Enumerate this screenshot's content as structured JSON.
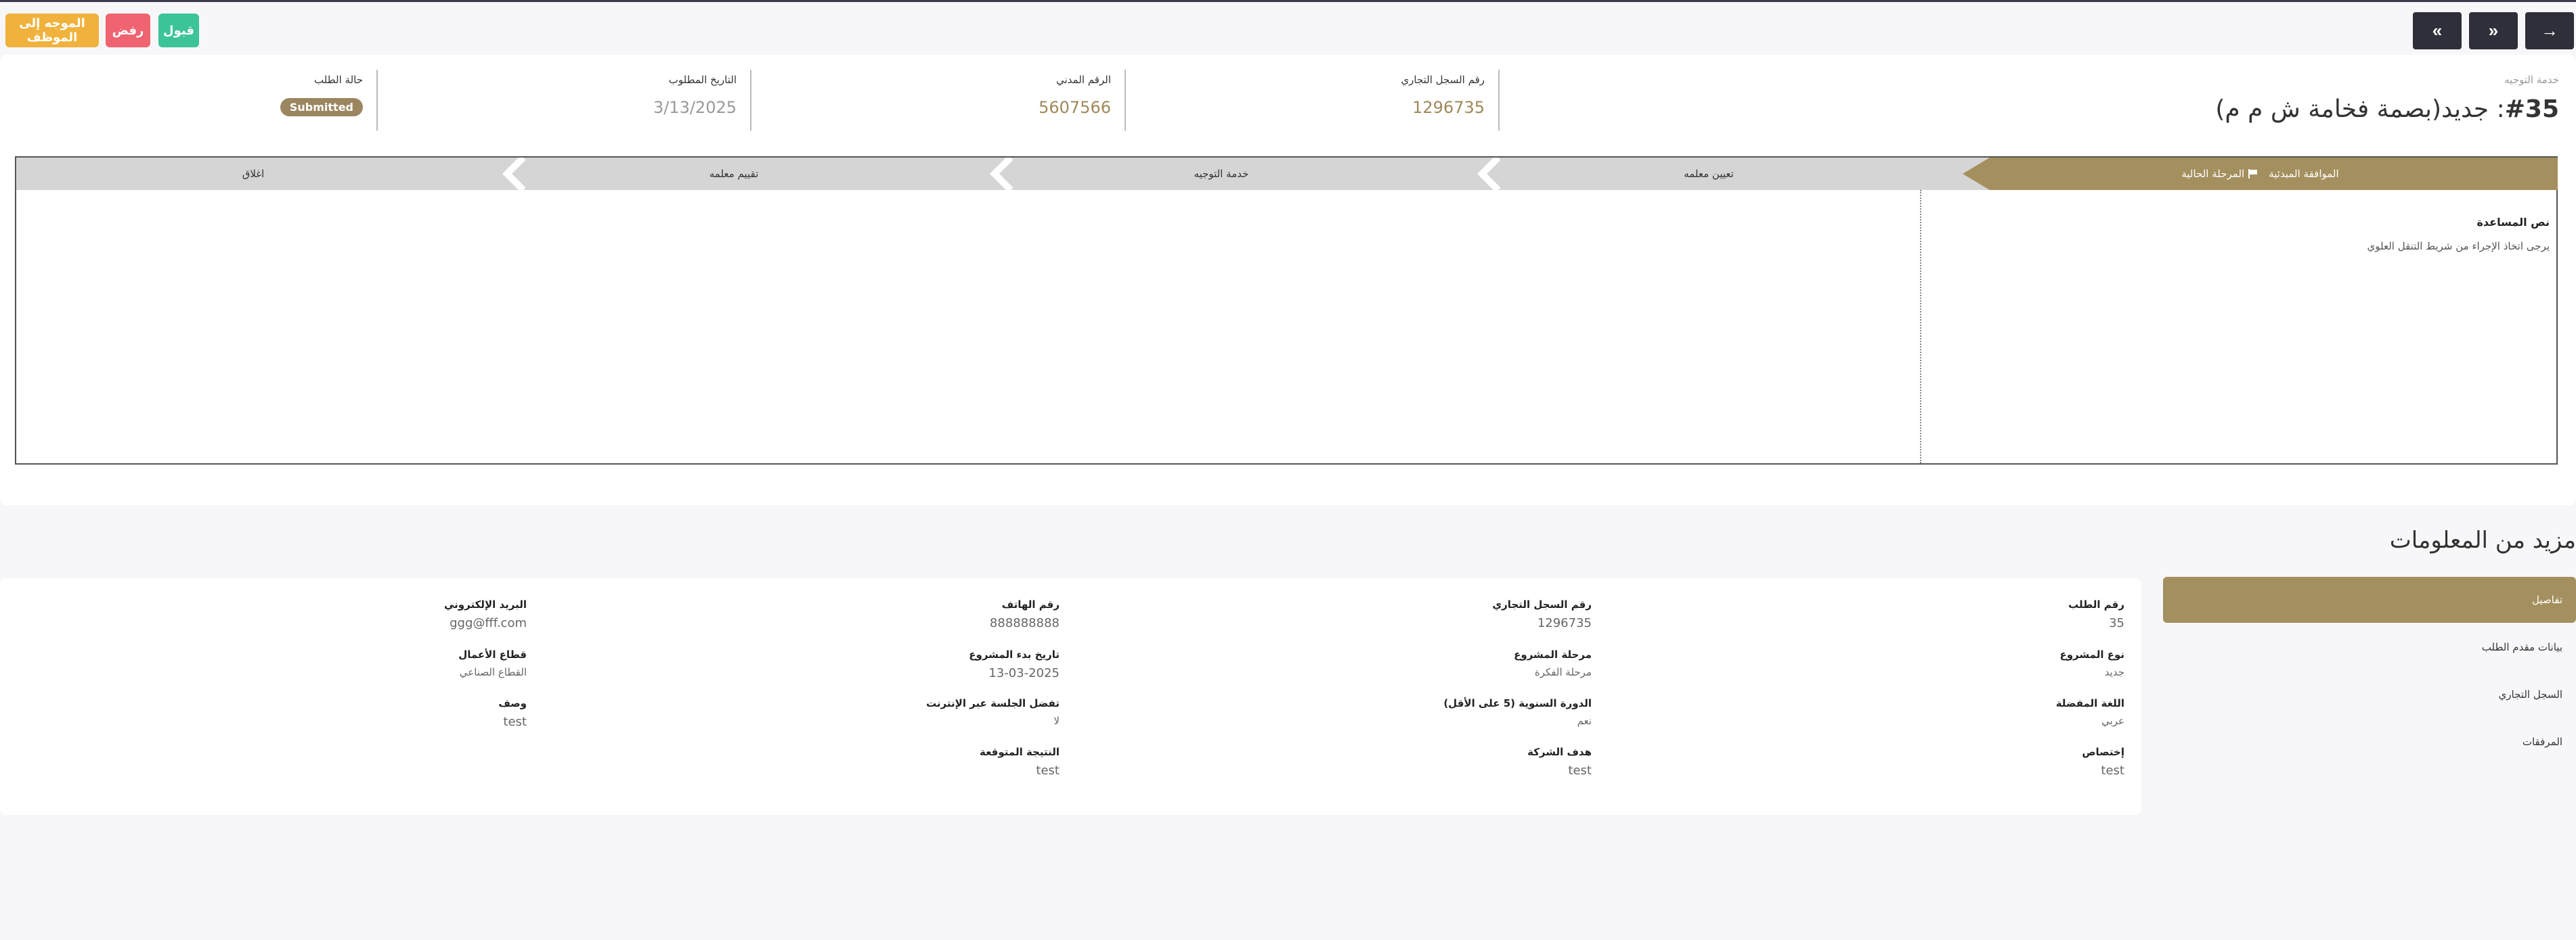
{
  "toolbar": {
    "nav": [
      "→",
      "»",
      "«"
    ],
    "accept_label": "قبول",
    "reject_label": "رفض",
    "assign_label": "الموجه إلى الموظف",
    "colors": {
      "accept": "#3cc39a",
      "reject": "#ef6470",
      "assign": "#f0b23c",
      "nav": "#2f2f3a"
    }
  },
  "header": {
    "service": "خدمة التوجيه",
    "title_num": "#35",
    "title_text": ": جديد(بصمة فخامة ش م م)",
    "info": [
      {
        "label": "رقم السجل التجاري",
        "value": "1296735"
      },
      {
        "label": "الرقم المدني",
        "value": "5607566"
      },
      {
        "label": "التاريخ المطلوب",
        "value": "3/13/2025"
      },
      {
        "label": "حالة الطلب",
        "value": "Submitted"
      }
    ]
  },
  "stages": {
    "items": [
      "الموافقة المبدئية",
      "تعيين معلمه",
      "خدمة التوجيه",
      "تقييم معلمه",
      "اغلاق"
    ],
    "current_label": "المرحلة الحالية",
    "help_title": "نص المساعدة",
    "help_text": "يرجى اتخاذ الإجراء من شريط التنقل العلوي"
  },
  "more": {
    "title": "مزيد من المعلومات",
    "tabs": [
      "تفاصيل",
      "بيانات مقدم الطلب",
      "السجل التجاري",
      "المرفقات"
    ],
    "fields": [
      {
        "label": "رقم الطلب",
        "value": "35"
      },
      {
        "label": "رقم السجل التجاري",
        "value": "1296735"
      },
      {
        "label": "رقم الهاتف",
        "value": "888888888"
      },
      {
        "label": "البريد الإلكتروني",
        "value": "ggg@fff.com"
      },
      {
        "label": "نوع المشروع",
        "value": "جديد"
      },
      {
        "label": "مرحلة المشروع",
        "value": "مرحلة الفكرة"
      },
      {
        "label": "تاريخ بدء المشروع",
        "value": "13-03-2025"
      },
      {
        "label": "قطاع الأعمال",
        "value": "القطاع الصناعي"
      },
      {
        "label": "اللغة المفضلة",
        "value": "عربي"
      },
      {
        "label": "الدورة السنوية (5 على الأقل)",
        "value": "نعم"
      },
      {
        "label": "تفضل الجلسة عبر الإنترنت",
        "value": "لا"
      },
      {
        "label": "وصف",
        "value": "test"
      },
      {
        "label": "إختصاص",
        "value": "test"
      },
      {
        "label": "هدف الشركة",
        "value": "test"
      },
      {
        "label": "النتيجة المتوقعة",
        "value": "test"
      }
    ]
  }
}
